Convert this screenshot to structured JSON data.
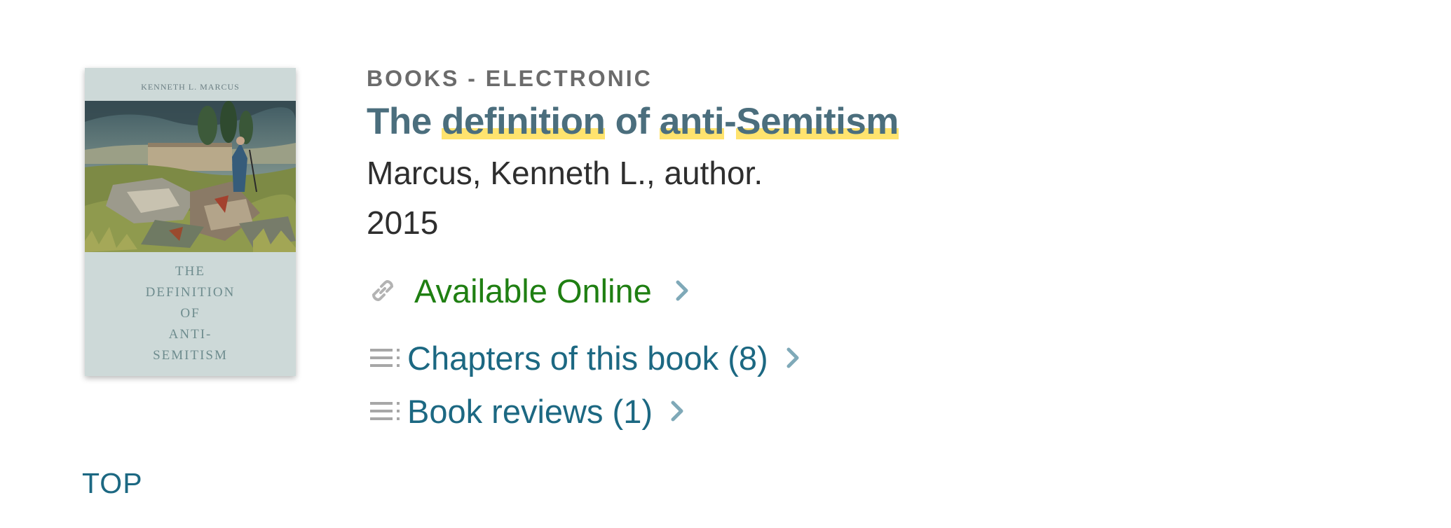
{
  "cover": {
    "author": "KENNETH L. MARCUS",
    "title": "THE\nDEFINITION\nOF\nANTI-\nSEMITISM"
  },
  "record": {
    "format": "BOOKS - ELECTRONIC",
    "title_parts": {
      "p1": "The ",
      "p2": "definition",
      "p3": " of ",
      "p4": "anti",
      "p5": "-",
      "p6": "Semitism"
    },
    "author": "Marcus, Kenneth L., author.",
    "year": "2015"
  },
  "availability": {
    "label": "Available Online",
    "icon": "link-icon",
    "color": "#1f7f12"
  },
  "links": {
    "chapters": "Chapters of this book (8)",
    "reviews": "Book reviews (1)",
    "icon": "list-icon"
  },
  "footer": {
    "top": "TOP"
  },
  "colors": {
    "title": "#4b6e7d",
    "link": "#1c6882",
    "highlight": "#ffe36e",
    "chevron": "#7fa9b8"
  }
}
